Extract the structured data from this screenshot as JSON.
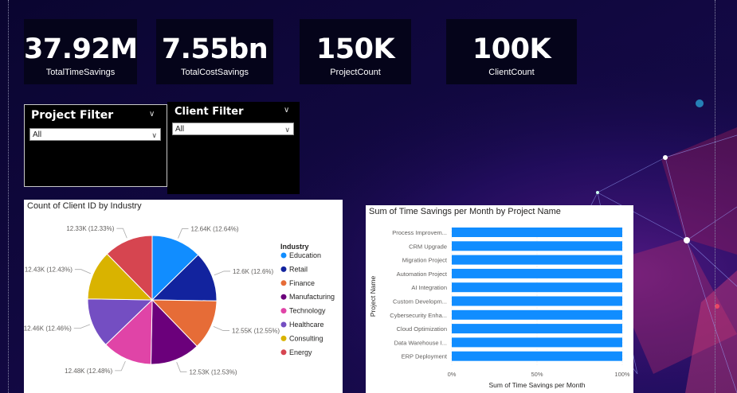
{
  "kpis": [
    {
      "value": "37.92M",
      "label": "TotalTimeSavings"
    },
    {
      "value": "7.55bn",
      "label": "TotalCostSavings"
    },
    {
      "value": "150K",
      "label": "ProjectCount"
    },
    {
      "value": "100K",
      "label": "ClientCount"
    }
  ],
  "project_filter": {
    "title": "Project Filter",
    "value": "All"
  },
  "client_filter": {
    "title": "Client Filter",
    "value": "All"
  },
  "icons": {
    "slicer_collapse": "chevron-down-icon",
    "dropdown_open": "chevron-down-icon"
  },
  "chart_data": [
    {
      "type": "pie",
      "title": "Count of Client ID by Industry",
      "legend_title": "Industry",
      "legend_position": "right",
      "slices": [
        {
          "name": "Education",
          "value": 12640,
          "label": "12.64K (12.64%)",
          "color": "#118DFF"
        },
        {
          "name": "Retail",
          "value": 12600,
          "label": "12.6K (12.6%)",
          "color": "#12239E"
        },
        {
          "name": "Finance",
          "value": 12550,
          "label": "12.55K (12.55%)",
          "color": "#E66C37"
        },
        {
          "name": "Manufacturing",
          "value": 12530,
          "label": "12.53K (12.53%)",
          "color": "#6B007B"
        },
        {
          "name": "Technology",
          "value": 12480,
          "label": "12.48K (12.48%)",
          "color": "#E044A7"
        },
        {
          "name": "Healthcare",
          "value": 12460,
          "label": "12.46K (12.46%)",
          "color": "#744EC2"
        },
        {
          "name": "Consulting",
          "value": 12430,
          "label": "12.43K (12.43%)",
          "color": "#D9B300"
        },
        {
          "name": "Energy",
          "value": 12330,
          "label": "12.33K (12.33%)",
          "color": "#D64550"
        }
      ]
    },
    {
      "type": "bar",
      "orientation": "horizontal",
      "stacking": "100%",
      "title": "Sum of Time Savings per Month by Project Name",
      "xlabel": "Sum of Time Savings per Month",
      "ylabel": "Project Name",
      "xlim": [
        0,
        100
      ],
      "x_ticks": [
        "0%",
        "50%",
        "100%"
      ],
      "color": "#118DFF",
      "categories": [
        "Process Improvem...",
        "CRM Upgrade",
        "Migration Project",
        "Automation Project",
        "AI Integration",
        "Custom Developm...",
        "Cybersecurity Enha...",
        "Cloud Optimization",
        "Data Warehouse I...",
        "ERP Deployment"
      ],
      "values": [
        100,
        100,
        100,
        100,
        100,
        100,
        100,
        100,
        100,
        100
      ]
    }
  ]
}
